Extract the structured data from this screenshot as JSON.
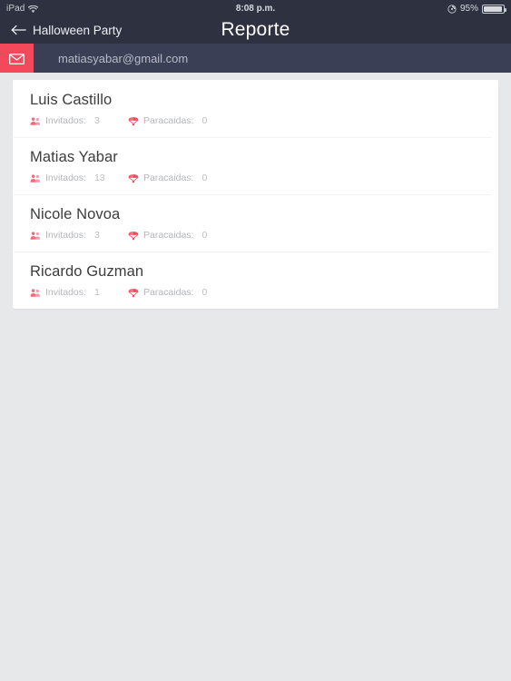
{
  "status_bar": {
    "carrier": "iPad",
    "wifi_icon": "wifi-icon",
    "time": "8:08 p.m.",
    "rotation_lock_icon": "rotation-lock-icon",
    "battery_percent": "95%",
    "battery_icon": "battery-icon"
  },
  "nav_bar": {
    "back_icon": "arrow-left-icon",
    "back_label": "Halloween Party",
    "title": "Reporte"
  },
  "email_bar": {
    "mail_icon": "envelope-icon",
    "email": "matiasyabar@gmail.com"
  },
  "labels": {
    "guests": "Invitados:",
    "crashers": "Paracaidas:",
    "guests_icon": "people-group-icon",
    "crashers_icon": "parachute-icon"
  },
  "colors": {
    "accent_red": "#f4495b",
    "nav_background": "#2e3240",
    "email_bar_background": "#3a3f55",
    "page_background": "#e7e8ea",
    "card_background": "#ffffff"
  },
  "rows": [
    {
      "name": "Luis Castillo",
      "guests": "3",
      "crashers": "0"
    },
    {
      "name": "Matias Yabar",
      "guests": "13",
      "crashers": "0"
    },
    {
      "name": "Nicole Novoa",
      "guests": "3",
      "crashers": "0"
    },
    {
      "name": "Ricardo Guzman",
      "guests": "1",
      "crashers": "0"
    }
  ]
}
